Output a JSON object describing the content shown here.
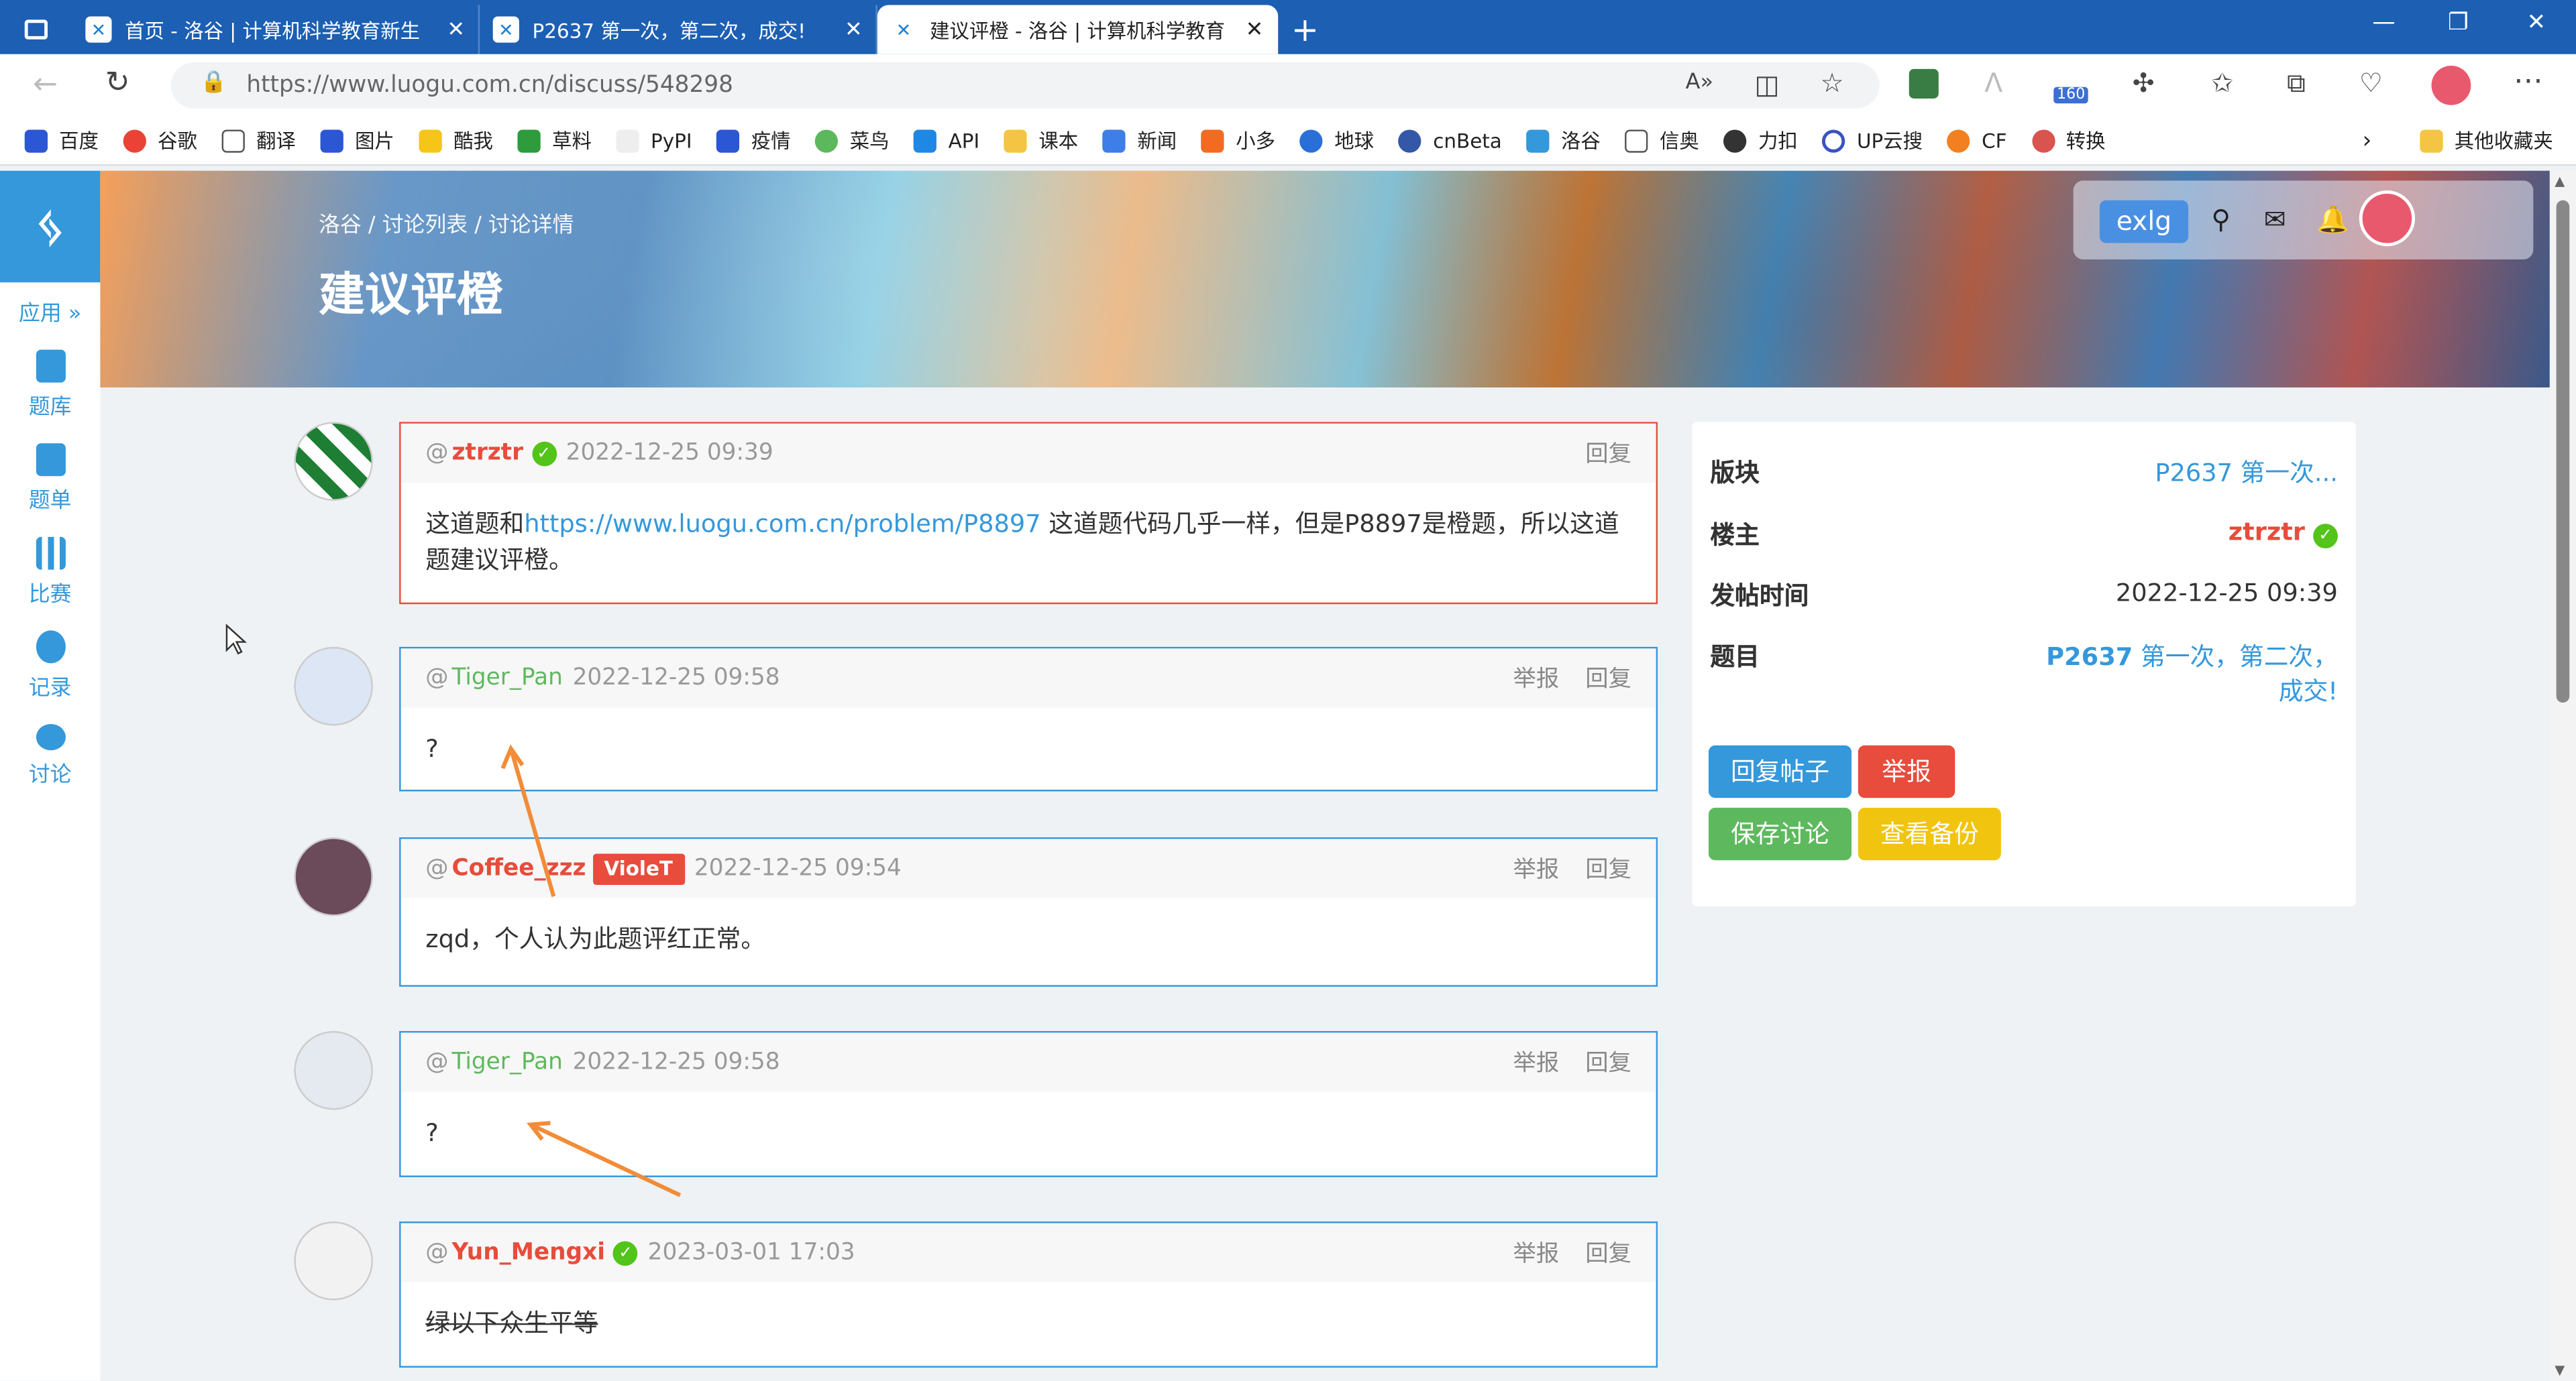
{
  "browser": {
    "tabs": [
      {
        "title": "首页 - 洛谷 | 计算机科学教育新生"
      },
      {
        "title": "P2637 第一次，第二次，成交!"
      },
      {
        "title": "建议评橙 - 洛谷 | 计算机科学教育"
      }
    ],
    "url": "https://www.luogu.com.cn/discuss/548298",
    "extension_badge": "160"
  },
  "bookmarks": [
    "百度",
    "谷歌",
    "翻译",
    "图片",
    "酷我",
    "草料",
    "PyPI",
    "疫情",
    "菜鸟",
    "API",
    "课本",
    "新闻",
    "小多",
    "地球",
    "cnBeta",
    "洛谷",
    "信奥",
    "力扣",
    "UP云搜",
    "CF",
    "转换"
  ],
  "bookmarks_other": "其他收藏夹",
  "sidebar": {
    "apps_label": "应用 »",
    "items": [
      {
        "label": "题库"
      },
      {
        "label": "题单"
      },
      {
        "label": "比赛"
      },
      {
        "label": "记录"
      },
      {
        "label": "讨论"
      }
    ]
  },
  "header": {
    "breadcrumb": "洛谷 / 讨论列表 / 讨论详情",
    "title": "建议评橙",
    "exlg": "exlg"
  },
  "posts": [
    {
      "user": "ztrztr",
      "time": "2022-12-25 09:39",
      "actions": [
        "回复"
      ],
      "content_prefix": "这道题和",
      "link": "https://www.luogu.com.cn/problem/P8897",
      "content_suffix": " 这道题代码几乎一样，但是P8897是橙题，所以这道题建议评橙。"
    },
    {
      "user": "Tiger_Pan",
      "time": "2022-12-25 09:58",
      "actions": [
        "举报",
        "回复"
      ],
      "content": "?"
    },
    {
      "user": "Coffee_zzz",
      "badge": "VioleT",
      "time": "2022-12-25 09:54",
      "actions": [
        "举报",
        "回复"
      ],
      "content": "zqd，个人认为此题评红正常。"
    },
    {
      "user": "Tiger_Pan",
      "time": "2022-12-25 09:58",
      "actions": [
        "举报",
        "回复"
      ],
      "content": "?"
    },
    {
      "user": "Yun_Mengxi",
      "time": "2023-03-01 17:03",
      "actions": [
        "举报",
        "回复"
      ],
      "content": "绿以下众生平等"
    }
  ],
  "info": {
    "board_label": "版块",
    "board_value": "P2637 第一次...",
    "owner_label": "楼主",
    "owner_value": "ztrztr",
    "time_label": "发帖时间",
    "time_value": "2022-12-25 09:39",
    "problem_label": "题目",
    "problem_id": "P2637",
    "problem_title": " 第一次，第二次，成交!",
    "buttons": [
      "回复帖子",
      "举报",
      "保存讨论",
      "查看备份"
    ]
  },
  "colors": {
    "accent": "#3498db",
    "red": "#e74c3c",
    "green": "#5eb95e",
    "orange": "#f1c40f"
  }
}
